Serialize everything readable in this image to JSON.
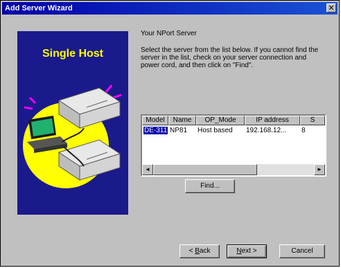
{
  "window": {
    "title": "Add Server Wizard",
    "close_glyph": "✕"
  },
  "sidebar": {
    "title": "Single Host",
    "colors": {
      "background": "#1a1a8c",
      "title": "#ffff00",
      "blob": "#ffff00"
    }
  },
  "main": {
    "heading": "Your NPort Server",
    "description": "Select the server from the list below. If you cannot find the server in the list, check on your server connection and power cord, and then click on \"Find\"."
  },
  "server_list": {
    "columns": [
      "Model",
      "Name",
      "OP_Mode",
      "IP address",
      "S"
    ],
    "rows": [
      {
        "model": "DE-311",
        "name": "NP81",
        "op_mode": "Host based",
        "ip": "192.168.12...",
        "s": "8"
      }
    ],
    "scroll_left_icon": "◄",
    "scroll_right_icon": "►"
  },
  "buttons": {
    "find": "Find...",
    "back_mnemonic": "B",
    "back_rest": "ack",
    "back_prefix": "< ",
    "next_mnemonic": "N",
    "next_rest": "ext >",
    "cancel": "Cancel"
  }
}
